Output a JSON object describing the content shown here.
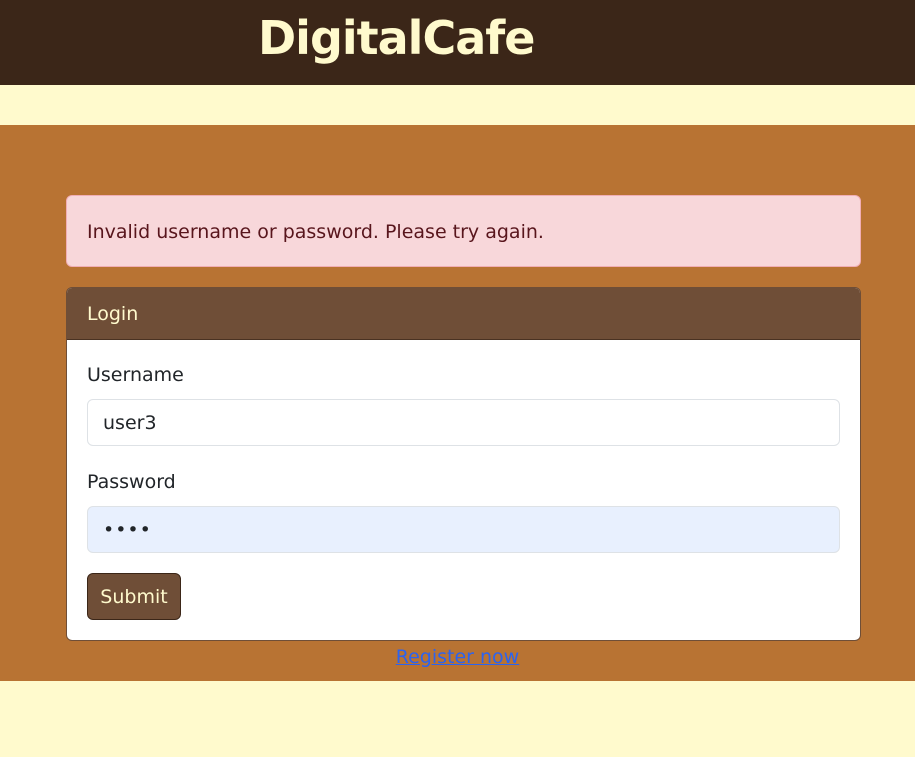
{
  "header": {
    "brand": "DigitalCafe"
  },
  "alert": {
    "message": "Invalid username or password. Please try again."
  },
  "login": {
    "title": "Login",
    "username_label": "Username",
    "username_value": "user3",
    "password_label": "Password",
    "password_value": "test",
    "submit_label": "Submit"
  },
  "footer": {
    "register_link": "Register now"
  },
  "colors": {
    "navbar": "#3b2618",
    "page_background": "#fffacd",
    "main_band": "#b87333",
    "card_header": "#6f4e37",
    "alert_background": "#f8d7da",
    "link": "#2b63f0"
  }
}
